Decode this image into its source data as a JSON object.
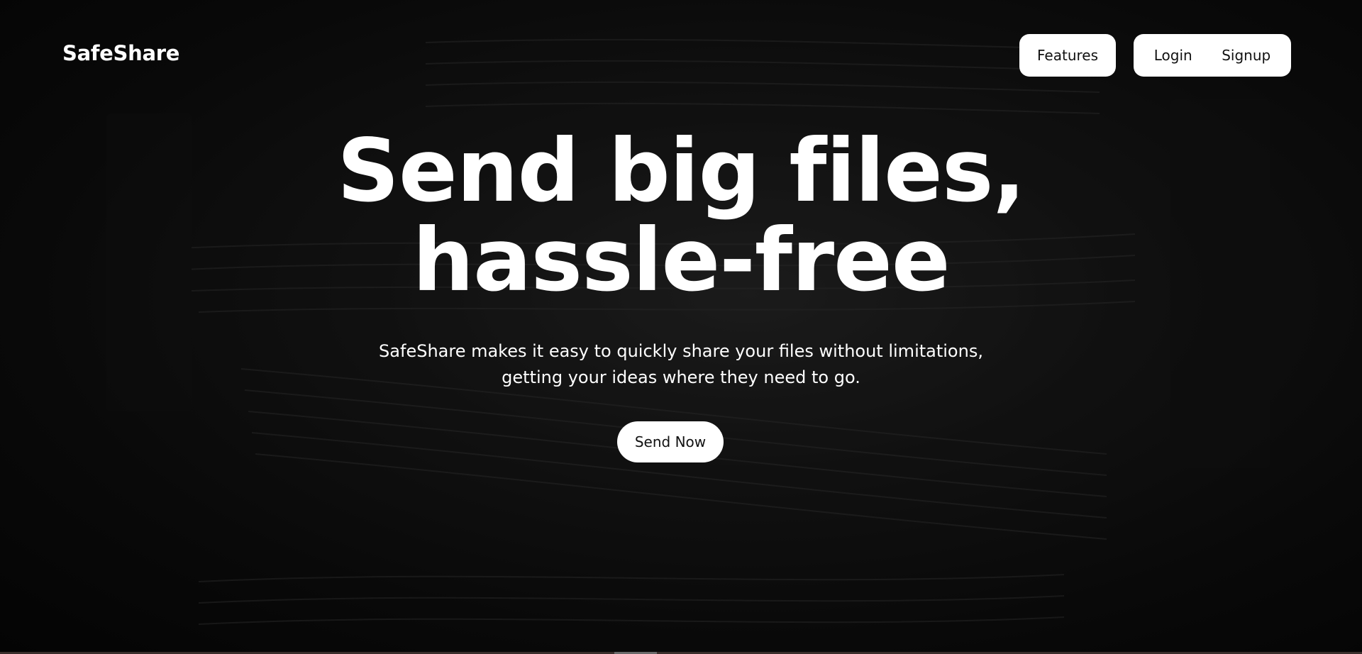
{
  "brand": {
    "name": "SafeShare"
  },
  "nav": {
    "features_label": "Features",
    "login_label": "Login",
    "signup_label": "Signup"
  },
  "hero": {
    "headline_line1": "Send big files,",
    "headline_line2": "hassle-free",
    "subtitle_line1": "SafeShare makes it easy to quickly share your files without limitations,",
    "subtitle_line2": "getting your ideas where they need to go.",
    "cta_label": "Send Now"
  },
  "colors": {
    "background": "#0b0b0b",
    "text": "#ffffff",
    "button_bg": "#ffffff",
    "button_text": "#111111"
  }
}
